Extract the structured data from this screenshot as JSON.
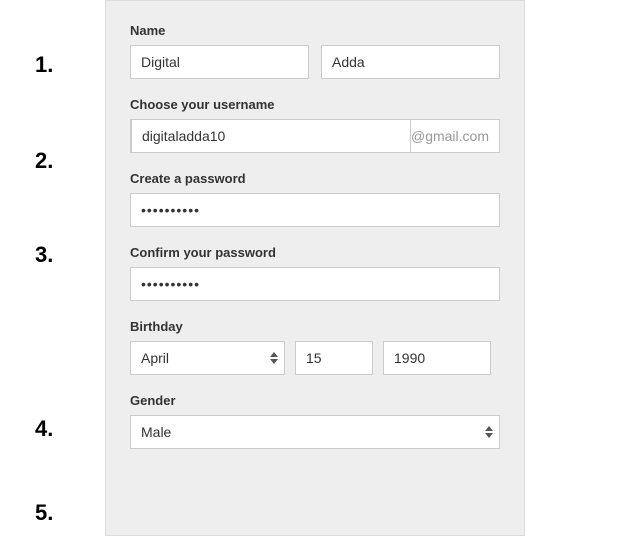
{
  "numbers": {
    "n1": "1.",
    "n2": "2.",
    "n3": "3.",
    "n4": "4.",
    "n5": "5."
  },
  "name": {
    "label": "Name",
    "first": "Digital",
    "last": "Adda"
  },
  "username": {
    "label": "Choose your username",
    "value": "digitaladda10",
    "suffix": "@gmail.com"
  },
  "password": {
    "create_label": "Create a password",
    "create_value": "••••••••••",
    "confirm_label": "Confirm your password",
    "confirm_value": "••••••••••"
  },
  "birthday": {
    "label": "Birthday",
    "month": "April",
    "day": "15",
    "year": "1990"
  },
  "gender": {
    "label": "Gender",
    "value": "Male"
  }
}
